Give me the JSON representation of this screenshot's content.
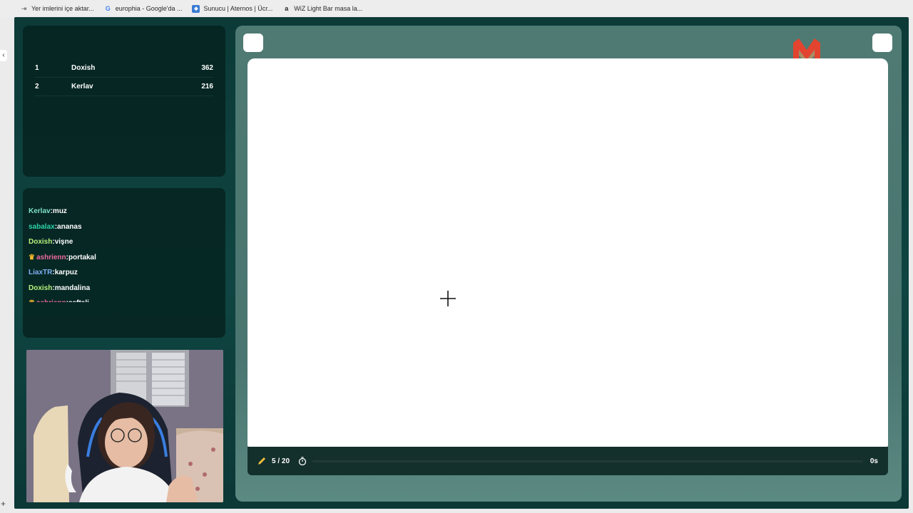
{
  "bookmarks": [
    {
      "label": "Yer imlerini içe aktar...",
      "icon": "import-icon"
    },
    {
      "label": "europhia - Google'da ...",
      "icon": "google-icon"
    },
    {
      "label": "Sunucu | Aternos | Ücr...",
      "icon": "aternos-icon"
    },
    {
      "label": "WiZ Light Bar masa la...",
      "icon": "amazon-icon"
    }
  ],
  "scoreboard": [
    {
      "rank": "1",
      "name": "Doxish",
      "points": "362"
    },
    {
      "rank": "2",
      "name": "Kerlav",
      "points": "216"
    }
  ],
  "chat": [
    {
      "user": "Kerlav",
      "separator": ":",
      "text": "muz",
      "color": "#7fe0c6",
      "crown": false
    },
    {
      "user": "sabalax",
      "separator": ":",
      "text": "ananas",
      "color": "#2ed3a8",
      "crown": false
    },
    {
      "user": "Doxish",
      "separator": ":",
      "text": "vişne",
      "color": "#b6f27c",
      "crown": false
    },
    {
      "user": "ashrienn",
      "separator": ":",
      "text": "portakal",
      "color": "#f06aa0",
      "crown": true
    },
    {
      "user": "LiaxTR",
      "separator": ":",
      "text": "karpuz",
      "color": "#7eb2f5",
      "crown": false
    },
    {
      "user": "Doxish",
      "separator": ":",
      "text": "mandalina",
      "color": "#b6f27c",
      "crown": false
    },
    {
      "user": "ashrienn",
      "separator": ":",
      "text": "şeftali",
      "color": "#f06aa0",
      "crown": true
    }
  ],
  "game": {
    "round": "5 / 20",
    "time_left": "0s",
    "timer_progress": 0
  },
  "colors": {
    "accent_logo": "#e2442f",
    "pencil": "#f5c23a",
    "crown": "#f5b82e"
  }
}
